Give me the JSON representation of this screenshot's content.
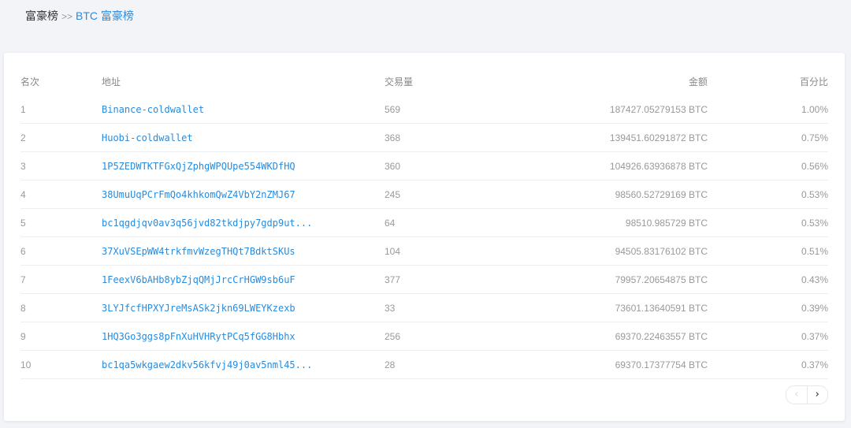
{
  "breadcrumb": {
    "root": "富豪榜",
    "separator": ">>",
    "current": "BTC 富豪榜"
  },
  "table": {
    "headers": {
      "rank": "名次",
      "address": "地址",
      "transactions": "交易量",
      "amount": "金额",
      "percent": "百分比"
    },
    "rows": [
      {
        "rank": "1",
        "address": "Binance-coldwallet",
        "transactions": "569",
        "amount": "187427.05279153 BTC",
        "percent": "1.00%"
      },
      {
        "rank": "2",
        "address": "Huobi-coldwallet",
        "transactions": "368",
        "amount": "139451.60291872 BTC",
        "percent": "0.75%"
      },
      {
        "rank": "3",
        "address": "1P5ZEDWTKTFGxQjZphgWPQUpe554WKDfHQ",
        "transactions": "360",
        "amount": "104926.63936878 BTC",
        "percent": "0.56%"
      },
      {
        "rank": "4",
        "address": "38UmuUqPCrFmQo4khkomQwZ4VbY2nZMJ67",
        "transactions": "245",
        "amount": "98560.52729169 BTC",
        "percent": "0.53%"
      },
      {
        "rank": "5",
        "address": "bc1qgdjqv0av3q56jvd82tkdjpy7gdp9ut...",
        "transactions": "64",
        "amount": "98510.985729 BTC",
        "percent": "0.53%"
      },
      {
        "rank": "6",
        "address": "37XuVSEpWW4trkfmvWzegTHQt7BdktSKUs",
        "transactions": "104",
        "amount": "94505.83176102 BTC",
        "percent": "0.51%"
      },
      {
        "rank": "7",
        "address": "1FeexV6bAHb8ybZjqQMjJrcCrHGW9sb6uF",
        "transactions": "377",
        "amount": "79957.20654875 BTC",
        "percent": "0.43%"
      },
      {
        "rank": "8",
        "address": "3LYJfcfHPXYJreMsASk2jkn69LWEYKzexb",
        "transactions": "33",
        "amount": "73601.13640591 BTC",
        "percent": "0.39%"
      },
      {
        "rank": "9",
        "address": "1HQ3Go3ggs8pFnXuHVHRytPCq5fGG8Hbhx",
        "transactions": "256",
        "amount": "69370.22463557 BTC",
        "percent": "0.37%"
      },
      {
        "rank": "10",
        "address": "bc1qa5wkgaew2dkv56kfvj49j0av5nml45...",
        "transactions": "28",
        "amount": "69370.17377754 BTC",
        "percent": "0.37%"
      }
    ]
  },
  "pagination": {
    "prev_icon": "chevron-left-icon",
    "next_icon": "chevron-right-icon",
    "prev_glyph": "‹",
    "next_glyph": "›"
  },
  "colors": {
    "link": "#2a8bdc",
    "background": "#f3f4f8"
  }
}
